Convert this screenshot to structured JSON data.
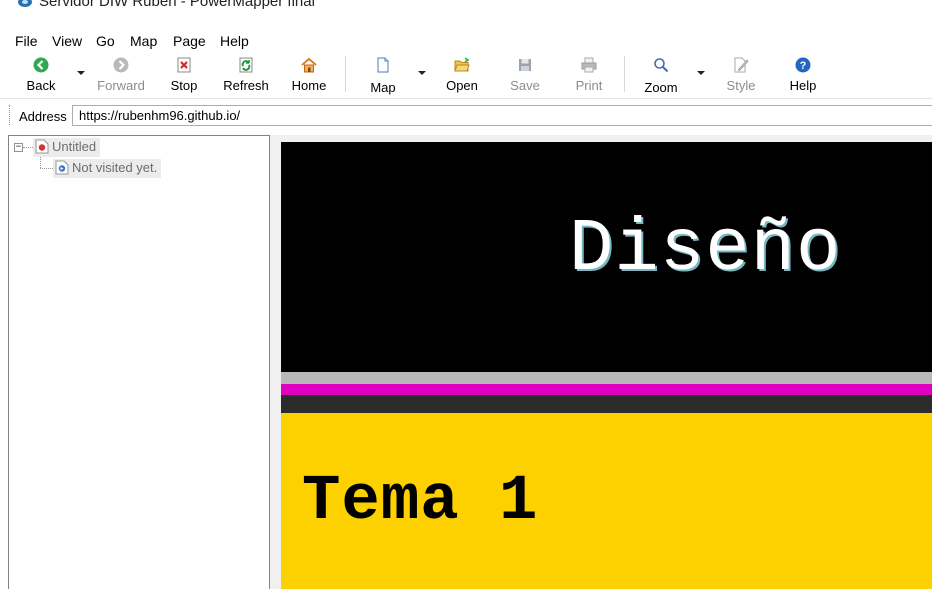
{
  "window": {
    "title": "Servidor DIW Rubén - PowerMapper final"
  },
  "menu": {
    "items": [
      "File",
      "View",
      "Go",
      "Map",
      "Page",
      "Help"
    ]
  },
  "toolbar": {
    "back": "Back",
    "forward": "Forward",
    "stop": "Stop",
    "refresh": "Refresh",
    "home": "Home",
    "map": "Map",
    "open": "Open",
    "save": "Save",
    "print": "Print",
    "zoom": "Zoom",
    "style": "Style",
    "help": "Help",
    "disabled_buttons": [
      "Forward",
      "Save",
      "Print",
      "Style"
    ]
  },
  "address": {
    "label": "Address",
    "value": "https://rubenhm96.github.io/"
  },
  "tree": {
    "root": {
      "label": "Untitled",
      "expander": "−"
    },
    "child": {
      "label": "Not visited yet."
    }
  },
  "page": {
    "heading": "Diseño",
    "topic": "Tema 1",
    "colors": {
      "header_bg": "#000000",
      "heading_text": "#ffffff",
      "stripe_grey": "#b8b8b8",
      "stripe_magenta": "#e000c0",
      "section_bg": "#fdd100"
    }
  },
  "icons": {
    "back": "green-left-arrow-icon",
    "forward": "grey-right-arrow-icon",
    "stop": "red-x-icon",
    "refresh": "green-refresh-icon",
    "home": "house-icon",
    "map": "document-icon",
    "open": "folder-open-icon",
    "save": "floppy-disk-icon",
    "print": "printer-icon",
    "zoom": "magnifier-icon",
    "style": "pencil-document-icon",
    "help": "question-mark-icon"
  }
}
